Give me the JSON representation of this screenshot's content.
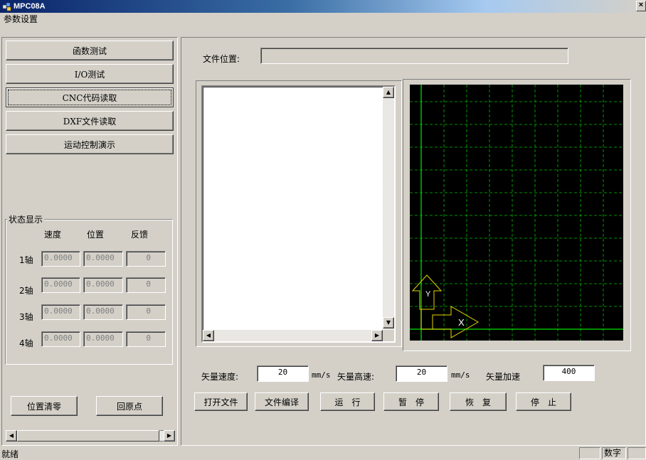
{
  "window": {
    "title": "MPC08A",
    "close": "×"
  },
  "menu": {
    "items": [
      "参数设置"
    ]
  },
  "left_panel": {
    "nav_buttons": [
      "函数测试",
      "I/O测试",
      "CNC代码读取",
      "DXF文件读取",
      "运动控制演示"
    ],
    "status_group": {
      "title": "状态显示",
      "headers": [
        "速度",
        "位置",
        "反馈"
      ],
      "axes": [
        {
          "label": "1轴",
          "speed": "0.0000",
          "position": "0.0000",
          "feedback": "0"
        },
        {
          "label": "2轴",
          "speed": "0.0000",
          "position": "0.0000",
          "feedback": "0"
        },
        {
          "label": "3轴",
          "speed": "0.0000",
          "position": "0.0000",
          "feedback": "0"
        },
        {
          "label": "4轴",
          "speed": "0.0000",
          "position": "0.0000",
          "feedback": "0"
        }
      ]
    },
    "zero_button": "位置清零",
    "home_button": "回原点"
  },
  "main": {
    "file_location_label": "文件位置:",
    "file_location_value": "",
    "plot": {
      "axis_y": "Y",
      "axis_x": "X",
      "background": "#000000",
      "grid_color": "#00c000",
      "axis_color": "#e6d600"
    },
    "params": {
      "vector_speed_label": "矢量速度:",
      "vector_speed_value": "20",
      "unit1": "mm/s",
      "vector_high_label": "矢量高速:",
      "vector_high_value": "20",
      "unit2": "mm/s",
      "vector_accel_label": "矢量加速",
      "vector_accel_value": "400"
    },
    "actions": [
      "打开文件",
      "文件编译",
      "运　行",
      "暂　停",
      "恢　复",
      "停　止"
    ]
  },
  "statusbar": {
    "text": "就绪",
    "num_indicator": "数字"
  }
}
